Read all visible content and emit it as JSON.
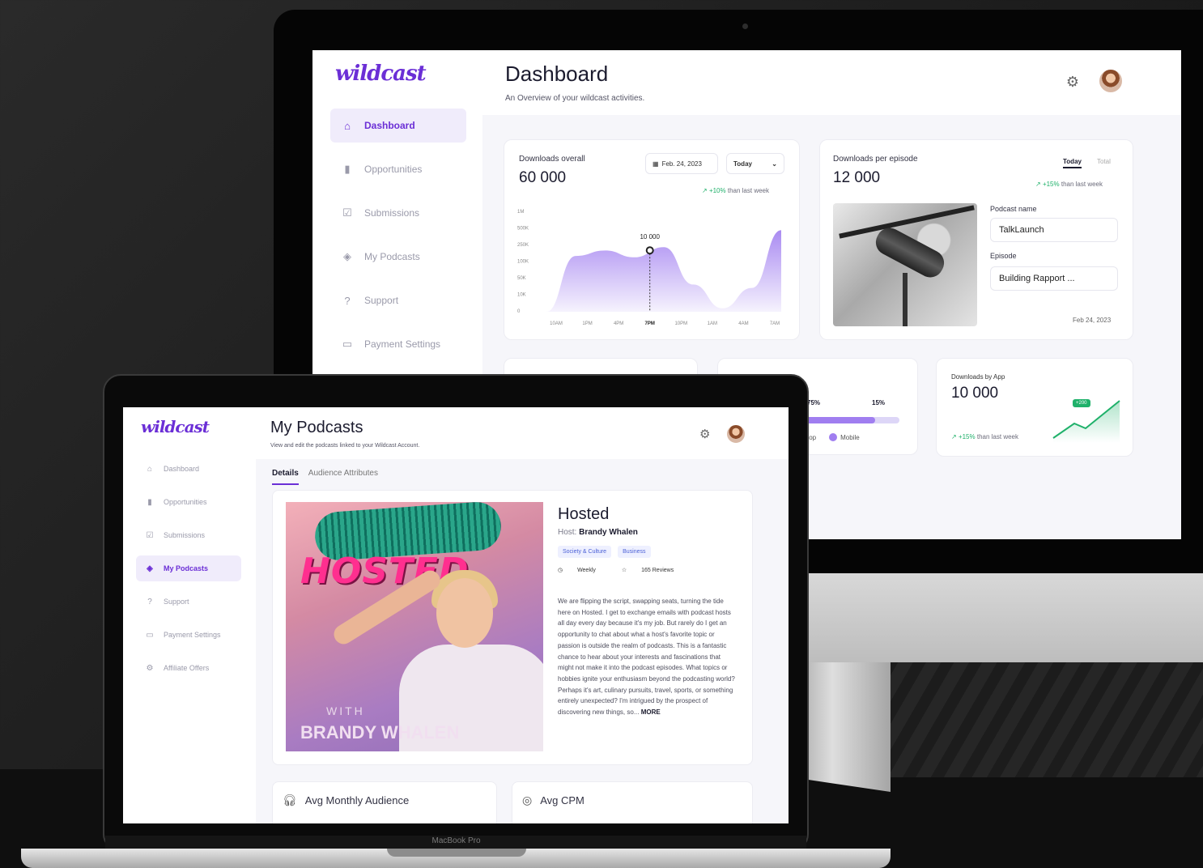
{
  "brand": {
    "logo": "wildcast",
    "accent": "#6b2fd6"
  },
  "dashboard": {
    "title": "Dashboard",
    "subtitle": "An Overview of your wildcast activities.",
    "nav": [
      {
        "label": "Dashboard",
        "icon": "home-icon",
        "active": true
      },
      {
        "label": "Opportunities",
        "icon": "bar-chart-icon",
        "active": false
      },
      {
        "label": "Submissions",
        "icon": "checkbox-icon",
        "active": false
      },
      {
        "label": "My Podcasts",
        "icon": "layers-icon",
        "active": false
      },
      {
        "label": "Support",
        "icon": "help-icon",
        "active": false
      },
      {
        "label": "Payment Settings",
        "icon": "card-icon",
        "active": false
      }
    ],
    "downloads": {
      "label": "Downloads overall",
      "value": "60 000",
      "date": "Feb. 24, 2023",
      "range": "Today",
      "trend": "+10%",
      "trend_text": "than last week",
      "marker_label": "10 000"
    },
    "episode": {
      "label": "Downloads per episode",
      "value": "12 000",
      "tab_today": "Today",
      "tab_total": "Total",
      "trend": "+15%",
      "trend_text": "than last week",
      "podcast_label": "Podcast name",
      "podcast_value": "TalkLaunch",
      "episode_label": "Episode",
      "episode_value": "Building Rapport ...",
      "date": "Feb 24, 2023"
    },
    "device": {
      "label_fragment": "ce",
      "pct_a": "75%",
      "pct_b": "15%",
      "legend_a": "top",
      "legend_b": "Mobile",
      "fill": 0.85
    },
    "apps": {
      "label": "Downloads by App",
      "value": "10 000",
      "trend": "+15%",
      "trend_text": "than last week",
      "badge": "+200"
    }
  },
  "chart_data": {
    "type": "area",
    "x": [
      "10AM",
      "1PM",
      "4PM",
      "7PM",
      "10PM",
      "1AM",
      "4AM",
      "7AM"
    ],
    "y_ticks": [
      "1M",
      "500K",
      "250K",
      "100K",
      "50K",
      "10K",
      "0"
    ],
    "y_levels": [
      0,
      0.82,
      0.9,
      0.8,
      0.95,
      0.4,
      0.05,
      0.35,
      1.2
    ],
    "highlight_index": 3,
    "highlight_label": "10 000",
    "color": "#a07ef0",
    "grid": false
  },
  "podcasts": {
    "title": "My Podcasts",
    "subtitle": "View and edit the podcasts linked to your Wildcast Account.",
    "nav": [
      {
        "label": "Dashboard",
        "icon": "home-icon",
        "active": false
      },
      {
        "label": "Opportunities",
        "icon": "bar-chart-icon",
        "active": false
      },
      {
        "label": "Submissions",
        "icon": "checkbox-icon",
        "active": false
      },
      {
        "label": "My Podcasts",
        "icon": "layers-icon",
        "active": true
      },
      {
        "label": "Support",
        "icon": "help-icon",
        "active": false
      },
      {
        "label": "Payment Settings",
        "icon": "card-icon",
        "active": false
      },
      {
        "label": "Affiliate Offers",
        "icon": "gear-icon",
        "active": false
      }
    ],
    "tabs": [
      "Details",
      "Audience Attributes"
    ],
    "cover": {
      "title": "HOSTED",
      "with": "WITH",
      "host": "BRANDY WHALEN"
    },
    "name": "Hosted",
    "host_label": "Host:",
    "host_name": "Brandy Whalen",
    "tags": [
      "Society & Culture",
      "Business"
    ],
    "frequency": "Weekly",
    "reviews": "165 Reviews",
    "description": "We are flipping the script, swapping seats, turning the tide here on Hosted. I get to exchange emails with podcast hosts all day every day because it's my job. But rarely do I get an opportunity to chat about what a host's favorite topic or passion is outside the realm of podcasts. This is a fantastic chance to hear about your interests and fascinations that might not make it into the podcast episodes. What topics or hobbies ignite your enthusiasm beyond the podcasting world? Perhaps it's art, culinary pursuits, travel, sports, or something entirely unexpected? I'm intrigued by the prospect of discovering new things, so...",
    "more": "MORE",
    "stats": [
      {
        "label": "Avg Monthly Audience",
        "icon": "headphones-icon"
      },
      {
        "label": "Avg CPM",
        "icon": "coins-icon"
      }
    ]
  },
  "device": {
    "laptop_label": "MacBook Pro"
  }
}
